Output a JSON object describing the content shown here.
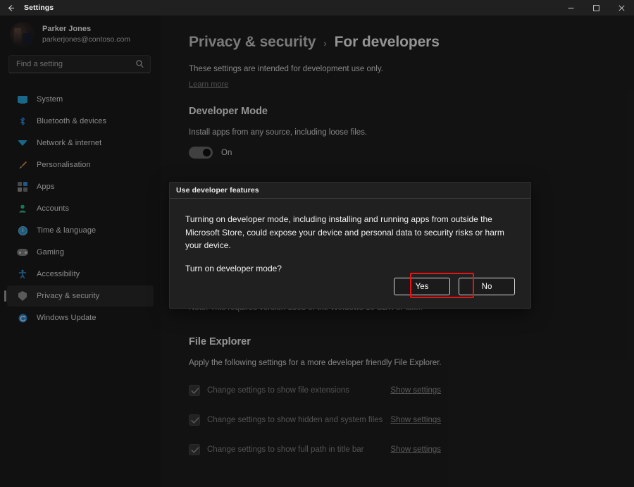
{
  "titlebar": {
    "back_icon": "back-arrow-icon",
    "title": "Settings",
    "minimize_label": "—",
    "maximize_label": "□",
    "close_label": "✕"
  },
  "sidebar": {
    "profile": {
      "name": "Parker Jones",
      "email": "parkerjones@contoso.com"
    },
    "search": {
      "placeholder": "Find a setting",
      "value": "",
      "icon": "search-icon"
    },
    "items": [
      {
        "label": "System",
        "icon": "monitor-icon",
        "selected": false
      },
      {
        "label": "Bluetooth & devices",
        "icon": "bluetooth-icon",
        "selected": false
      },
      {
        "label": "Network & internet",
        "icon": "wifi-icon",
        "selected": false
      },
      {
        "label": "Personalisation",
        "icon": "paintbrush-icon",
        "selected": false
      },
      {
        "label": "Apps",
        "icon": "apps-grid-icon",
        "selected": false
      },
      {
        "label": "Accounts",
        "icon": "person-icon",
        "selected": false
      },
      {
        "label": "Time & language",
        "icon": "clock-icon",
        "selected": false
      },
      {
        "label": "Gaming",
        "icon": "gamepad-icon",
        "selected": false
      },
      {
        "label": "Accessibility",
        "icon": "accessibility-icon",
        "selected": false
      },
      {
        "label": "Privacy & security",
        "icon": "shield-icon",
        "selected": true
      },
      {
        "label": "Windows Update",
        "icon": "refresh-icon",
        "selected": false
      }
    ]
  },
  "content": {
    "breadcrumb": {
      "parent": "Privacy & security",
      "separator": "›",
      "current": "For developers"
    },
    "lead": "These settings are intended for development use only.",
    "learn_more": "Learn more",
    "developer_mode": {
      "title": "Developer Mode",
      "description": "Install apps from any source, including loose files.",
      "toggle_state": "On"
    },
    "note": "Note: This requires version 1803 of the Windows 10 SDK or later.",
    "file_explorer": {
      "title": "File Explorer",
      "description": "Apply the following settings for a more developer friendly File Explorer.",
      "rows": [
        {
          "label": "Change settings to show file extensions",
          "link": "Show settings",
          "checked": true
        },
        {
          "label": "Change settings to show hidden and system files",
          "link": "Show settings",
          "checked": true
        },
        {
          "label": "Change settings to show full path in title bar",
          "link": "Show settings",
          "checked": true
        }
      ]
    }
  },
  "dialog": {
    "header_title": "Use developer features",
    "paragraph": "Turning on developer mode, including installing and running apps from outside the Microsoft Store, could expose your device and personal data to security risks or harm your device.",
    "question": "Turn on developer mode?",
    "yes_label": "Yes",
    "no_label": "No"
  },
  "annotation": {
    "highlight_color": "#ee1111",
    "target": "yes-button"
  }
}
